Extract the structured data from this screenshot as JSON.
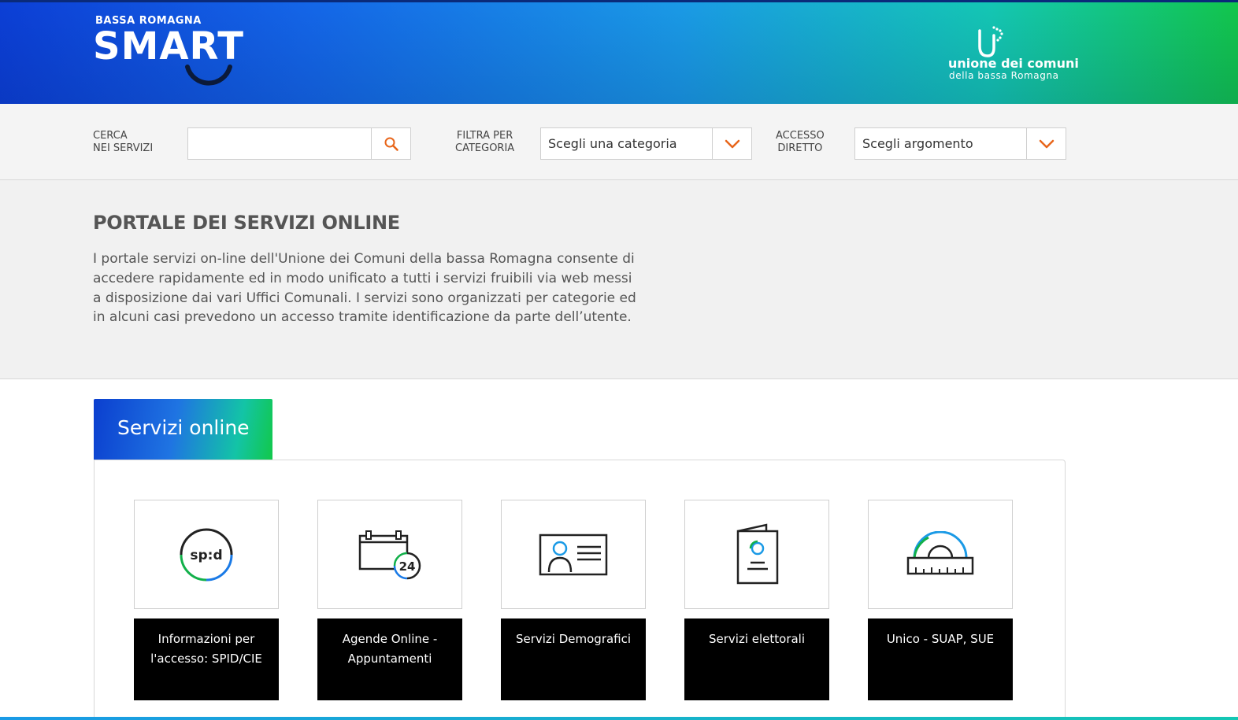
{
  "header": {
    "brand_small": "BASSA ROMAGNA",
    "brand_big": "SMART",
    "union_line1": "unione dei comuni",
    "union_line2": "della bassa Romagna"
  },
  "searchbar": {
    "search_label_1": "CERCA",
    "search_label_2": "NEI SERVIZI",
    "search_value": "",
    "filter_label_1": "FILTRA PER",
    "filter_label_2": "CATEGORIA",
    "filter_selected": "Scegli una categoria",
    "access_label_1": "ACCESSO",
    "access_label_2": "DIRETTO",
    "access_selected": "Scegli argomento",
    "accent_color": "#e8661b"
  },
  "intro": {
    "title": "PORTALE DEI SERVIZI ONLINE",
    "text": "I portale servizi on-line dell'Unione dei Comuni della bassa Romagna consente di accedere rapidamente ed in modo unificato a tutti i servizi fruibili via web messi a disposizione dai vari Uffici Comunali. I servizi sono organizzati per categorie ed in alcuni casi prevedono un accesso tramite identificazione da parte dell’utente."
  },
  "services": {
    "tab_label": "Servizi online",
    "cards": [
      {
        "label": "Informazioni per l'accesso: SPID/CIE",
        "icon": "spid-icon",
        "icon_text": "sp:d"
      },
      {
        "label": "Agende Online - Appuntamenti",
        "icon": "calendar-24-icon",
        "icon_text": "24"
      },
      {
        "label": "Servizi Demografici",
        "icon": "id-card-icon"
      },
      {
        "label": "Servizi elettorali",
        "icon": "document-person-icon"
      },
      {
        "label": "Unico - SUAP, SUE",
        "icon": "protractor-ruler-icon"
      }
    ]
  }
}
